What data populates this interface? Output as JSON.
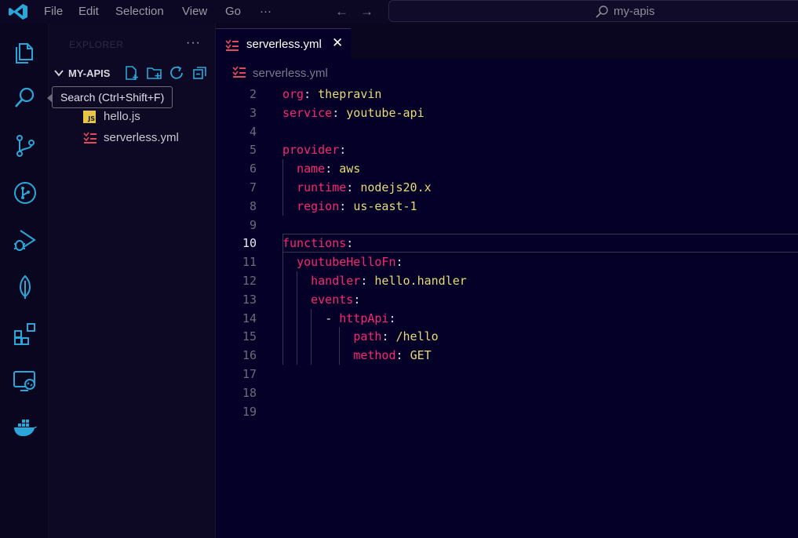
{
  "menu": {
    "file": "File",
    "edit": "Edit",
    "selection": "Selection",
    "view": "View",
    "go": "Go",
    "more": "···"
  },
  "command_center": {
    "text": "my-apis"
  },
  "activity_bar": {
    "icons": [
      "explorer-icon",
      "search-icon",
      "source-control-icon",
      "git-graph-icon",
      "run-debug-icon",
      "mongodb-leaf-icon",
      "extensions-icon",
      "remote-explorer-icon",
      "docker-icon"
    ]
  },
  "tooltip": {
    "text": "Search (Ctrl+Shift+F)"
  },
  "sidebar": {
    "title": "EXPLORER",
    "more": "···",
    "folder": "MY-APIS",
    "files": [
      {
        "name": "hello.js",
        "icon": "js-file-icon"
      },
      {
        "name": "serverless.yml",
        "icon": "yaml-file-icon"
      }
    ]
  },
  "editor": {
    "tab_label": "serverless.yml",
    "close_glyph": "✕",
    "breadcrumb": "serverless.yml",
    "current_line": 10,
    "lines": [
      {
        "n": "2",
        "tokens": [
          {
            "t": "org",
            "c": "k"
          },
          {
            "t": ": ",
            "c": "p"
          },
          {
            "t": "thepravin",
            "c": "v"
          }
        ]
      },
      {
        "n": "3",
        "tokens": [
          {
            "t": "service",
            "c": "k"
          },
          {
            "t": ": ",
            "c": "p"
          },
          {
            "t": "youtube-api",
            "c": "v"
          }
        ]
      },
      {
        "n": "4",
        "tokens": []
      },
      {
        "n": "5",
        "tokens": [
          {
            "t": "provider",
            "c": "k"
          },
          {
            "t": ":",
            "c": "p"
          }
        ]
      },
      {
        "n": "6",
        "tokens": [
          {
            "t": "  ",
            "c": "p"
          },
          {
            "t": "name",
            "c": "k"
          },
          {
            "t": ": ",
            "c": "p"
          },
          {
            "t": "aws",
            "c": "v"
          }
        ]
      },
      {
        "n": "7",
        "tokens": [
          {
            "t": "  ",
            "c": "p"
          },
          {
            "t": "runtime",
            "c": "k"
          },
          {
            "t": ": ",
            "c": "p"
          },
          {
            "t": "nodejs20.x",
            "c": "v"
          }
        ]
      },
      {
        "n": "8",
        "tokens": [
          {
            "t": "  ",
            "c": "p"
          },
          {
            "t": "region",
            "c": "k"
          },
          {
            "t": ": ",
            "c": "p"
          },
          {
            "t": "us-east-1",
            "c": "v"
          }
        ]
      },
      {
        "n": "9",
        "tokens": []
      },
      {
        "n": "10",
        "tokens": [
          {
            "t": "functions",
            "c": "k"
          },
          {
            "t": ":",
            "c": "p"
          }
        ]
      },
      {
        "n": "11",
        "tokens": [
          {
            "t": "  ",
            "c": "p"
          },
          {
            "t": "youtubeHelloFn",
            "c": "k"
          },
          {
            "t": ":",
            "c": "p"
          }
        ]
      },
      {
        "n": "12",
        "tokens": [
          {
            "t": "    ",
            "c": "p"
          },
          {
            "t": "handler",
            "c": "k"
          },
          {
            "t": ": ",
            "c": "p"
          },
          {
            "t": "hello.handler",
            "c": "v"
          }
        ]
      },
      {
        "n": "13",
        "tokens": [
          {
            "t": "    ",
            "c": "p"
          },
          {
            "t": "events",
            "c": "k"
          },
          {
            "t": ":",
            "c": "p"
          }
        ]
      },
      {
        "n": "14",
        "tokens": [
          {
            "t": "      ",
            "c": "p"
          },
          {
            "t": "- ",
            "c": "p"
          },
          {
            "t": "httpApi",
            "c": "k"
          },
          {
            "t": ":",
            "c": "p"
          }
        ]
      },
      {
        "n": "15",
        "tokens": [
          {
            "t": "          ",
            "c": "p"
          },
          {
            "t": "path",
            "c": "k"
          },
          {
            "t": ": ",
            "c": "p"
          },
          {
            "t": "/hello",
            "c": "v"
          }
        ]
      },
      {
        "n": "16",
        "tokens": [
          {
            "t": "          ",
            "c": "p"
          },
          {
            "t": "method",
            "c": "k"
          },
          {
            "t": ": ",
            "c": "p"
          },
          {
            "t": "GET",
            "c": "v"
          }
        ]
      },
      {
        "n": "17",
        "tokens": []
      },
      {
        "n": "18",
        "tokens": []
      },
      {
        "n": "19",
        "tokens": []
      }
    ]
  },
  "colors": {
    "keyword": "#f92672",
    "value": "#e6db74",
    "accent": "#2aa7d8",
    "yaml_icon": "#e04a5a"
  }
}
